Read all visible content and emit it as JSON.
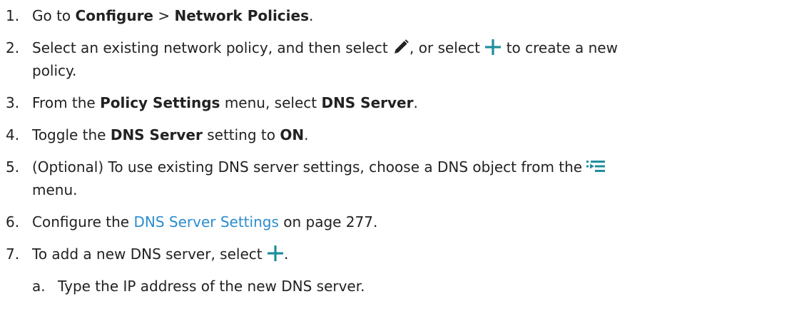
{
  "icons": {
    "edit": "pencil-icon",
    "add": "plus-icon",
    "menu": "object-list-menu-icon",
    "accent": "#1f8e9e"
  },
  "link_color": "#2b8ccf",
  "steps": [
    {
      "num": "1.",
      "a": "Go to ",
      "b1": "Configure",
      "c": " > ",
      "b2": "Network Policies",
      "d": "."
    },
    {
      "num": "2.",
      "a": "Select an existing network policy, and then select ",
      "b": ", or select ",
      "c": " to create a new",
      "d": "policy."
    },
    {
      "num": "3.",
      "a": "From the ",
      "b1": "Policy Settings",
      "c": " menu, select ",
      "b2": "DNS Server",
      "d": "."
    },
    {
      "num": "4.",
      "a": "Toggle the ",
      "b1": "DNS Server",
      "c": " setting to ",
      "b2": "ON",
      "d": "."
    },
    {
      "num": "5.",
      "a": "(Optional) To use existing DNS server settings, choose a DNS object from the ",
      "b": "menu."
    },
    {
      "num": "6.",
      "a": "Configure the ",
      "link": "DNS Server Settings",
      "b": " on page 277."
    },
    {
      "num": "7.",
      "a": "To add a new DNS server, select ",
      "b": "."
    },
    {
      "num": "a.",
      "a": "Type the IP address of the new DNS server."
    }
  ]
}
